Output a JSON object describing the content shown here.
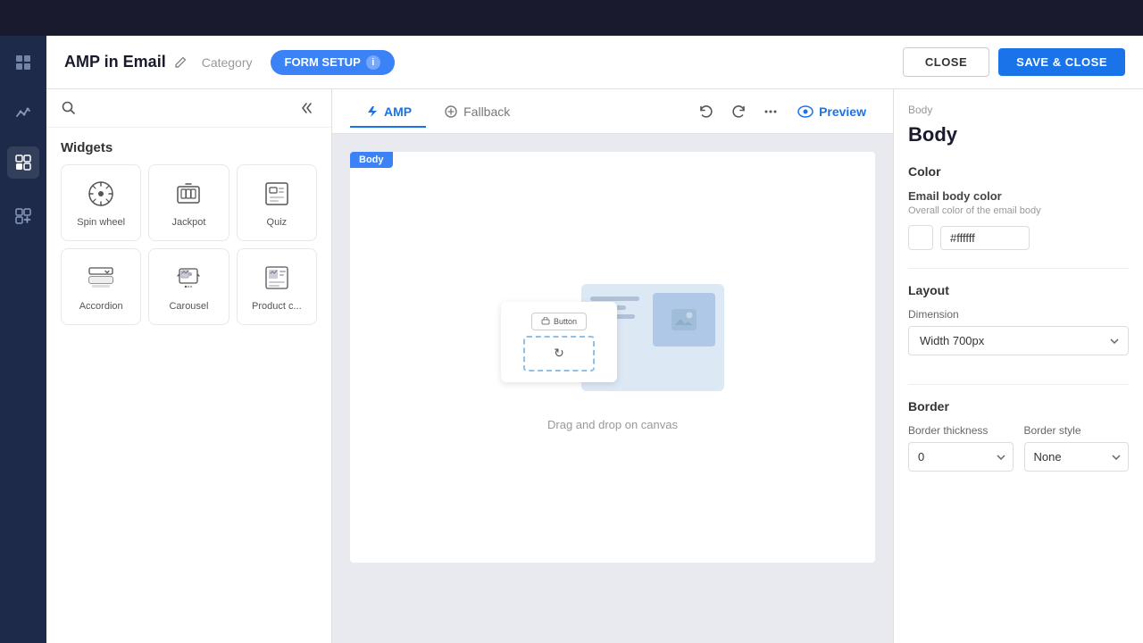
{
  "topbar": {
    "background": "#1a1a2e"
  },
  "header": {
    "app_title": "AMP in Email",
    "category_placeholder": "Category",
    "form_setup_label": "FORM SETUP",
    "close_label": "CLOSE",
    "save_close_label": "SAVE & CLOSE"
  },
  "tabs": {
    "amp_label": "AMP",
    "fallback_label": "Fallback",
    "preview_label": "Preview"
  },
  "widgets": {
    "section_title": "Widgets",
    "items": [
      {
        "id": "spin-wheel",
        "label": "Spin wheel"
      },
      {
        "id": "jackpot",
        "label": "Jackpot"
      },
      {
        "id": "quiz",
        "label": "Quiz"
      },
      {
        "id": "accordion",
        "label": "Accordion"
      },
      {
        "id": "carousel",
        "label": "Carousel"
      },
      {
        "id": "product-c",
        "label": "Product c..."
      }
    ]
  },
  "canvas": {
    "body_tag": "Body",
    "drag_drop_text": "Drag and drop on canvas",
    "button_widget_label": "Button"
  },
  "properties": {
    "breadcrumb": "Body",
    "title": "Body",
    "color_section": "Color",
    "email_body_color_label": "Email body color",
    "email_body_color_sublabel": "Overall color of the email body",
    "color_hex": "#ffffff",
    "layout_section": "Layout",
    "dimension_label": "Dimension",
    "dimension_value": "Width 700px",
    "border_section": "Border",
    "border_thickness_label": "Border thickness",
    "border_style_label": "Border style",
    "border_thickness_value": "0",
    "border_style_value": "None"
  }
}
